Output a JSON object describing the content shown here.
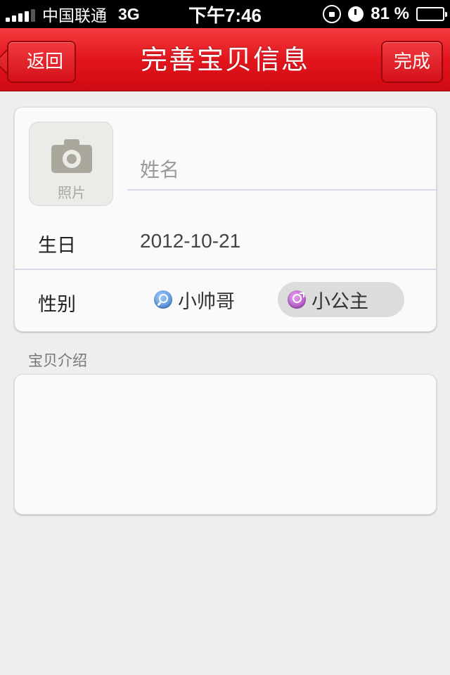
{
  "status_bar": {
    "carrier": "中国联通",
    "network": "3G",
    "time": "下午7:46",
    "battery_percent": "81 %",
    "battery_level": 0.81,
    "signal_bars_active": 4,
    "signal_bars_total": 5,
    "icons": [
      "signal-icon",
      "rotation-lock-icon",
      "alarm-icon",
      "battery-icon"
    ]
  },
  "nav": {
    "title": "完善宝贝信息",
    "back_label": "返回",
    "done_label": "完成",
    "accent_color": "#e3151d"
  },
  "form": {
    "photo_label": "照片",
    "photo_icon": "camera-icon",
    "name_placeholder": "姓名",
    "name_value": "",
    "birthday_label": "生日",
    "birthday_value": "2012-10-21",
    "gender_label": "性别",
    "gender_options": [
      {
        "label": "小帅哥",
        "icon": "male-icon",
        "selected": false
      },
      {
        "label": "小公主",
        "icon": "female-icon",
        "selected": true
      }
    ]
  },
  "intro": {
    "label": "宝贝介绍",
    "value": ""
  }
}
